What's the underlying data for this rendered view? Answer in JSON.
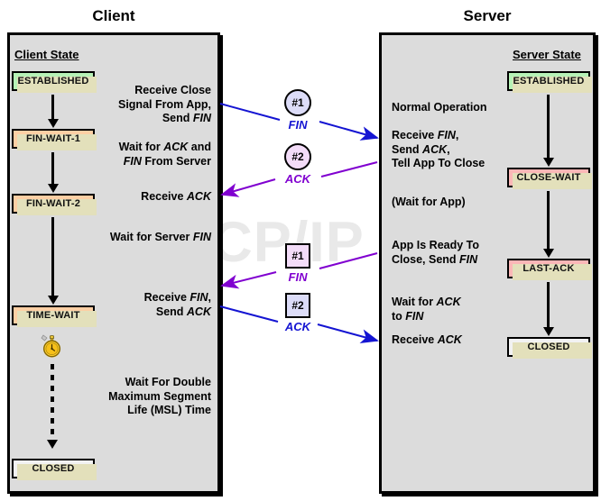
{
  "columns": {
    "client_title": "Client",
    "server_title": "Server"
  },
  "watermark": "The TCP/IP Guide",
  "client": {
    "state_header": "Client State",
    "states": [
      {
        "label": "ESTABLISHED",
        "color": "#b6f2b6"
      },
      {
        "label": "FIN-WAIT-1",
        "color": "#fdcfa4"
      },
      {
        "label": "FIN-WAIT-2",
        "color": "#fdcfa4"
      },
      {
        "label": "TIME-WAIT",
        "color": "#fdcfa4"
      },
      {
        "label": "CLOSED",
        "color": "#f2f2f2"
      }
    ],
    "descriptions": [
      "Receive Close\nSignal From App,\nSend FIN",
      "Wait for ACK and\nFIN From Server",
      "Receive ACK",
      "Wait for Server FIN",
      "Receive FIN,\nSend ACK",
      "Wait For Double\nMaximum Segment\nLife (MSL) Time"
    ],
    "timer_icon": "stopwatch-icon"
  },
  "server": {
    "state_header": "Server State",
    "states": [
      {
        "label": "ESTABLISHED",
        "color": "#b6f2b6"
      },
      {
        "label": "CLOSE-WAIT",
        "color": "#fbb7b7"
      },
      {
        "label": "LAST-ACK",
        "color": "#fbb7b7"
      },
      {
        "label": "CLOSED",
        "color": "#f2f2f2"
      }
    ],
    "descriptions": [
      "Normal Operation",
      "Receive FIN,\nSend ACK,\nTell App To Close",
      "(Wait for App)",
      "App Is Ready To\nClose, Send FIN",
      "Wait for ACK\nto FIN",
      "Receive ACK"
    ]
  },
  "messages": [
    {
      "badge": "#1",
      "label": "FIN",
      "shape": "circle",
      "fill": "#dcdcf8",
      "color": "#1414d2",
      "direction": "client-to-server"
    },
    {
      "badge": "#2",
      "label": "ACK",
      "shape": "circle",
      "fill": "#f3dcf8",
      "color": "#8000d0",
      "direction": "server-to-client"
    },
    {
      "badge": "#1",
      "label": "FIN",
      "shape": "square",
      "fill": "#f3dcf8",
      "color": "#8000d0",
      "direction": "server-to-client"
    },
    {
      "badge": "#2",
      "label": "ACK",
      "shape": "square",
      "fill": "#dcdcf8",
      "color": "#1414d2",
      "direction": "client-to-server"
    }
  ],
  "colors": {
    "panel_bg": "#dcdcdc",
    "shadow": "#e3e0bb",
    "blue": "#1414d2",
    "purple": "#8000d0"
  }
}
